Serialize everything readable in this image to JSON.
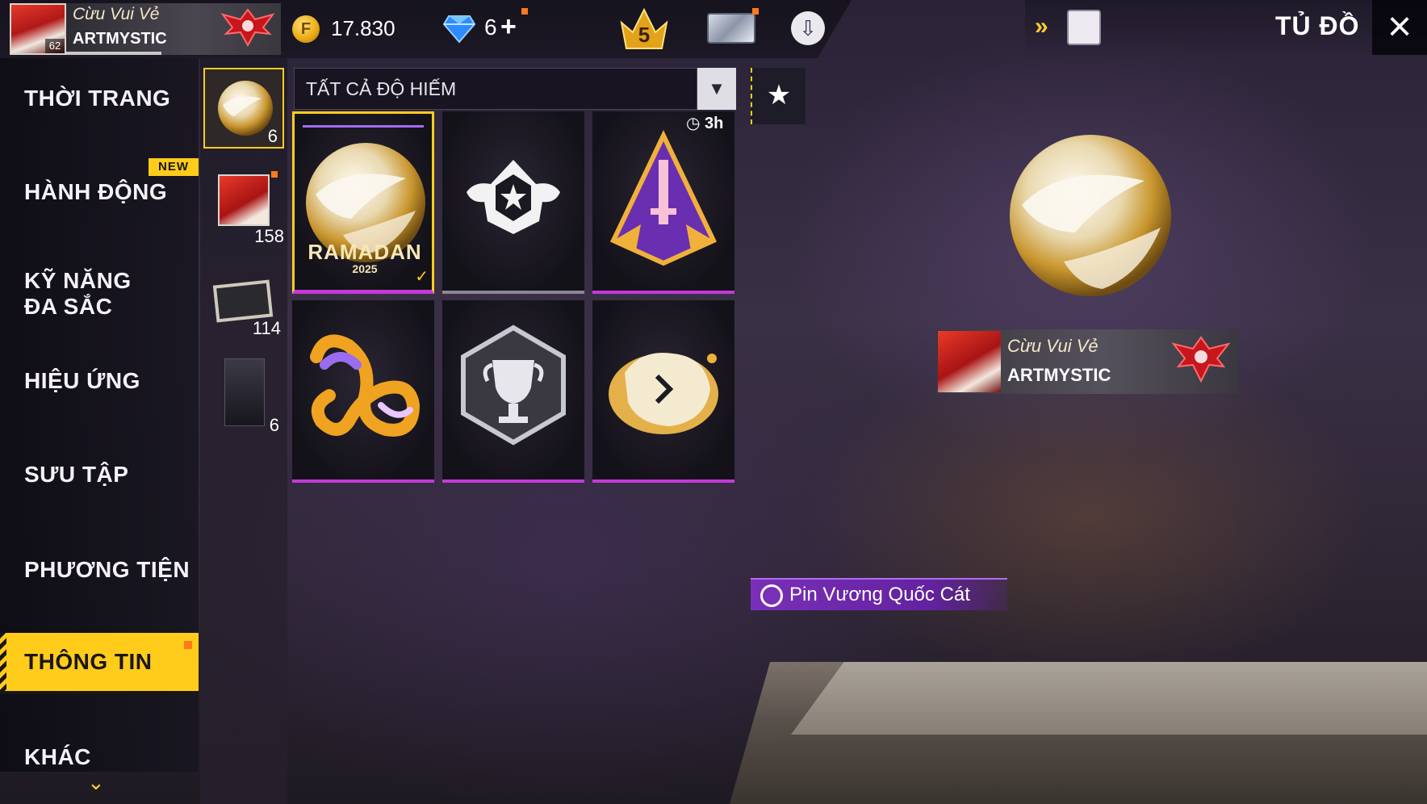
{
  "header": {
    "player_name": "Cừu Vui Vẻ",
    "guild_name": "ARTMYSTIC",
    "level": "62",
    "gold": "17.830",
    "diamonds": "6",
    "diamonds_plus": "+",
    "rank_level": "5",
    "page_title": "TỦ ĐỒ"
  },
  "icons": {
    "coin": "coin-icon",
    "diamond": "diamond-icon",
    "rank": "rank-crown-icon",
    "card": "membership-card-icon",
    "cloud": "cloud-download-icon",
    "switch": "character-switch-icon",
    "close": "close-icon",
    "favorite": "star-icon"
  },
  "colors": {
    "accent": "#ffcc1c",
    "rarity_purple": "#c33ad8",
    "rarity_gray": "#8b8792"
  },
  "nav": {
    "items": [
      {
        "label": "THỜI TRANG"
      },
      {
        "label": "HÀNH ĐỘNG"
      },
      {
        "label": "KỸ NĂNG ĐA SẮC"
      },
      {
        "label": "HIỆU ỨNG"
      },
      {
        "label": "SƯU TẬP"
      },
      {
        "label": "PHƯƠNG TIỆN"
      },
      {
        "label": "THÔNG TIN",
        "active": true
      },
      {
        "label": "KHÁC"
      }
    ],
    "new_badge": "NEW"
  },
  "subcategories": [
    {
      "name": "pin",
      "count": "6",
      "selected": true
    },
    {
      "name": "avatar",
      "count": "158"
    },
    {
      "name": "banner",
      "count": "114"
    },
    {
      "name": "character-card",
      "count": "6"
    }
  ],
  "filter": {
    "label": "TẤT CẢ ĐỘ HIẾM"
  },
  "grid": {
    "timer": "3h",
    "ramadan_text": "RAMADAN",
    "ramadan_year": "2025"
  },
  "preview": {
    "player_name": "Cừu Vui Vẻ",
    "guild_name": "ARTMYSTIC",
    "item_name": "Pin Vương Quốc Cát"
  }
}
